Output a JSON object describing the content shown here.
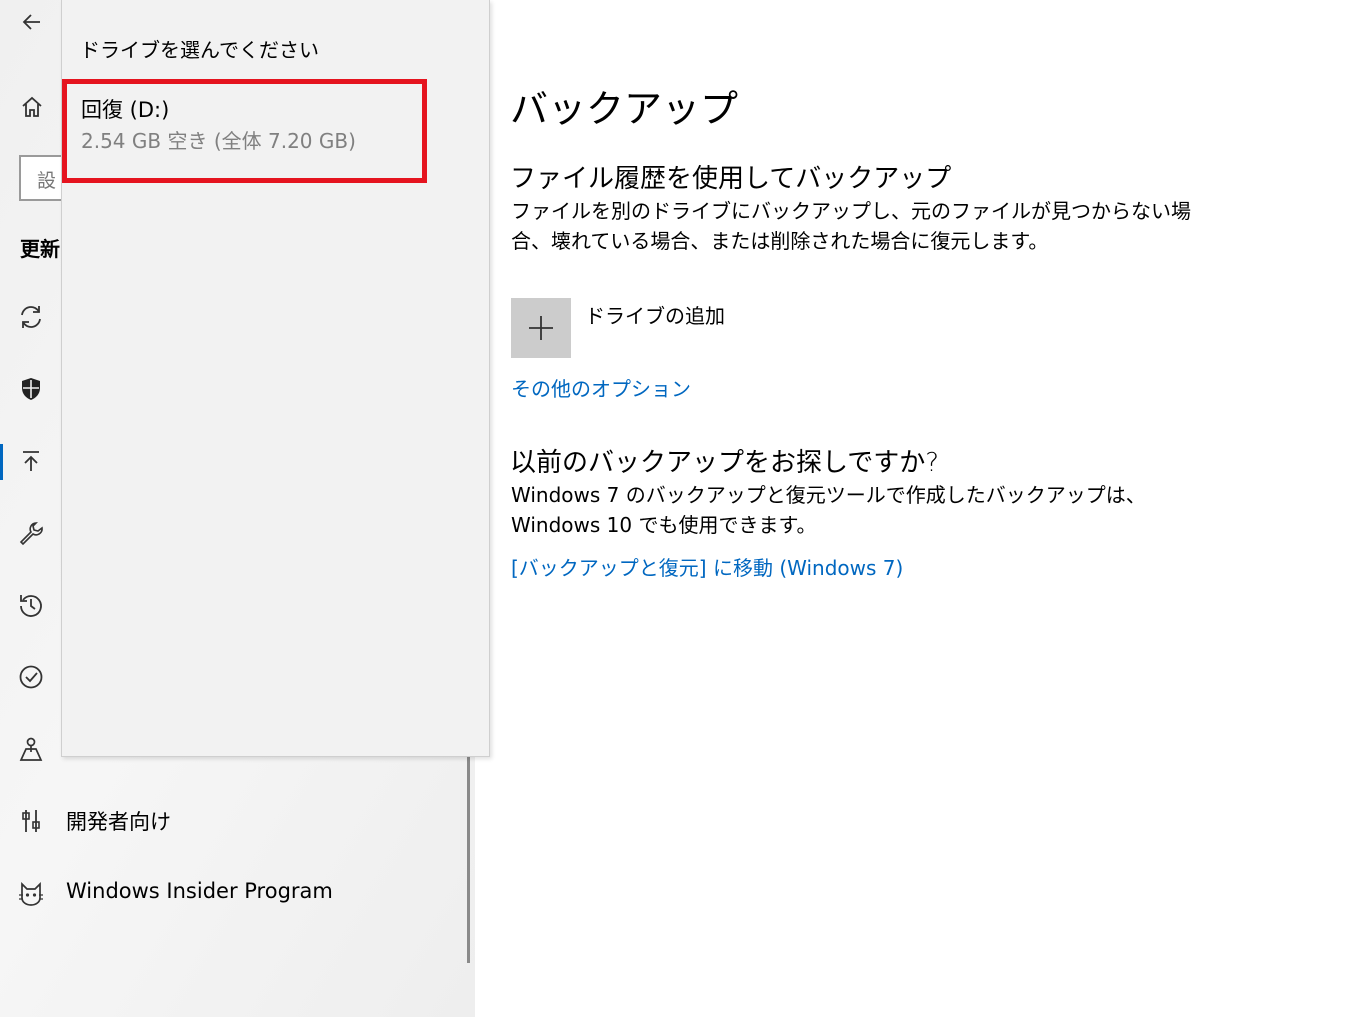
{
  "sidebar": {
    "search_placeholder": "設",
    "section_title": "更新",
    "items": [
      {
        "label": "",
        "icon": "sync-icon"
      },
      {
        "label": "",
        "icon": "shield-icon"
      },
      {
        "label": "",
        "icon": "upload-icon",
        "selected": true
      },
      {
        "label": "",
        "icon": "wrench-icon"
      },
      {
        "label": "",
        "icon": "history-icon"
      },
      {
        "label": "",
        "icon": "check-circle-icon"
      },
      {
        "label": "",
        "icon": "find-device-icon"
      },
      {
        "label": "開発者向け",
        "icon": "developer-tools-icon"
      },
      {
        "label": "Windows Insider Program",
        "icon": "insider-cat-icon"
      }
    ]
  },
  "flyout": {
    "title": "ドライブを選んでください",
    "drive": {
      "name": "回復 (D:)",
      "info": "2.54 GB 空き (全体 7.20 GB)"
    }
  },
  "main": {
    "page_title": "バックアップ",
    "file_history": {
      "heading": "ファイル履歴を使用してバックアップ",
      "description": "ファイルを別のドライブにバックアップし、元のファイルが見つからない場合、壊れている場合、または削除された場合に復元します。",
      "add_drive_label": "ドライブの追加",
      "more_options_link": "その他のオプション"
    },
    "older_backup": {
      "heading": "以前のバックアップをお探しですか?",
      "description": "Windows 7 のバックアップと復元ツールで作成したバックアップは、Windows 10 でも使用できます。",
      "link": "[バックアップと復元] に移動 (Windows 7)"
    }
  },
  "colors": {
    "accent": "#0067c0",
    "highlight_border": "#e5141f",
    "flyout_background": "#f2f2f2",
    "tile_background": "#cccccc"
  }
}
